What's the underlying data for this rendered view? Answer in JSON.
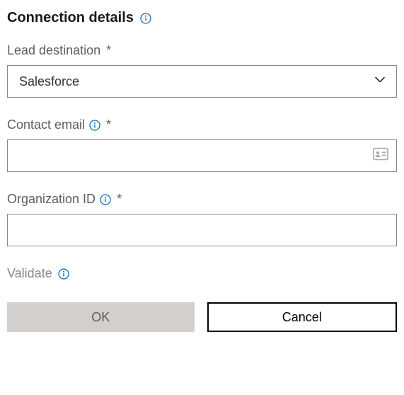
{
  "section": {
    "title": "Connection details"
  },
  "fields": {
    "lead_destination": {
      "label": "Lead destination",
      "required": "*",
      "selected": "Salesforce"
    },
    "contact_email": {
      "label": "Contact email",
      "required": "*",
      "value": ""
    },
    "organization_id": {
      "label": "Organization ID",
      "required": "*",
      "value": ""
    }
  },
  "validate": {
    "label": "Validate"
  },
  "buttons": {
    "ok": "OK",
    "cancel": "Cancel"
  }
}
